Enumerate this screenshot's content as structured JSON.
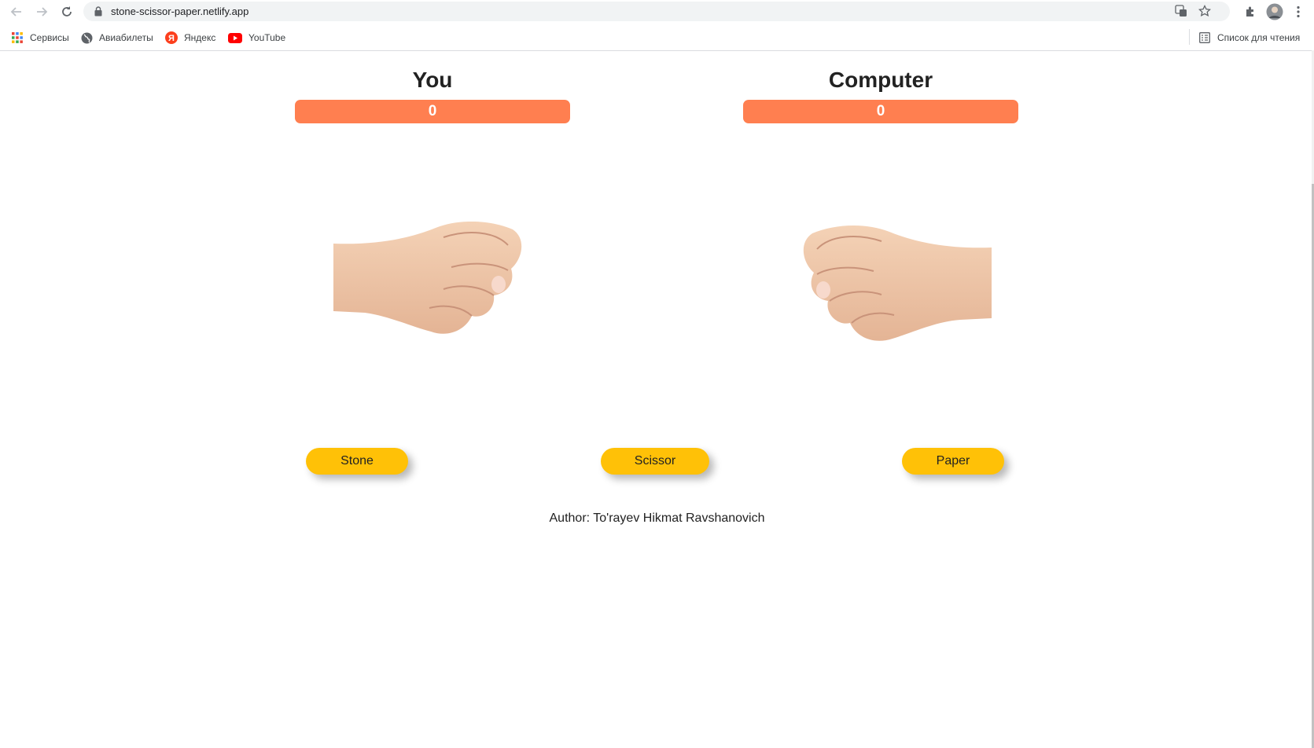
{
  "browser": {
    "url": "stone-scissor-paper.netlify.app",
    "bookmarks": [
      {
        "label": "Сервисы",
        "icon": "apps-grid-icon"
      },
      {
        "label": "Авиабилеты",
        "icon": "globe-icon"
      },
      {
        "label": "Яндекс",
        "icon": "yandex-icon"
      },
      {
        "label": "YouTube",
        "icon": "youtube-icon"
      }
    ],
    "reading_list": "Список для чтения"
  },
  "game": {
    "player": {
      "title": "You",
      "score": "0"
    },
    "computer": {
      "title": "Computer",
      "score": "0"
    },
    "buttons": {
      "stone": "Stone",
      "scissor": "Scissor",
      "paper": "Paper"
    },
    "author": "Author: To'rayev Hikmat Ravshanovich"
  },
  "colors": {
    "score_bar": "#ff7f50",
    "button": "#ffc107"
  }
}
